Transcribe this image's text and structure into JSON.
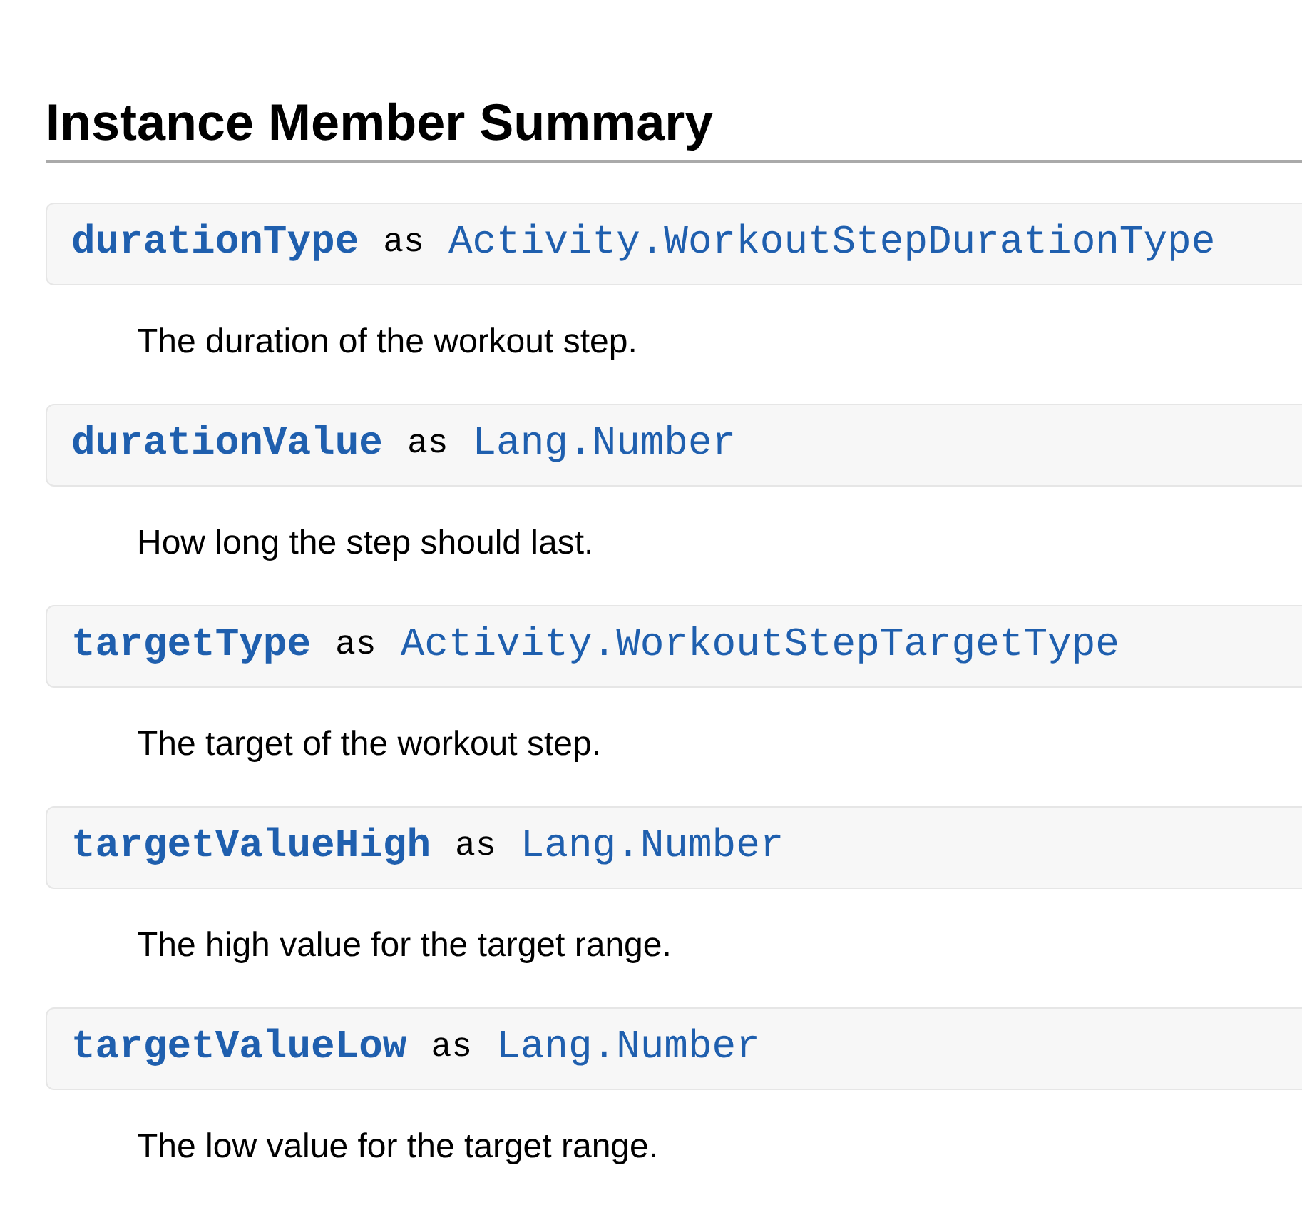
{
  "heading": "Instance Member Summary",
  "members": [
    {
      "name": "durationType",
      "keyword": "as",
      "type": "Activity.WorkoutStepDurationType",
      "description": "The duration of the workout step."
    },
    {
      "name": "durationValue",
      "keyword": "as",
      "type": "Lang.Number",
      "description": "How long the step should last."
    },
    {
      "name": "targetType",
      "keyword": "as",
      "type": "Activity.WorkoutStepTargetType",
      "description": "The target of the workout step."
    },
    {
      "name": "targetValueHigh",
      "keyword": "as",
      "type": "Lang.Number",
      "description": "The high value for the target range."
    },
    {
      "name": "targetValueLow",
      "keyword": "as",
      "type": "Lang.Number",
      "description": "The low value for the target range."
    }
  ]
}
